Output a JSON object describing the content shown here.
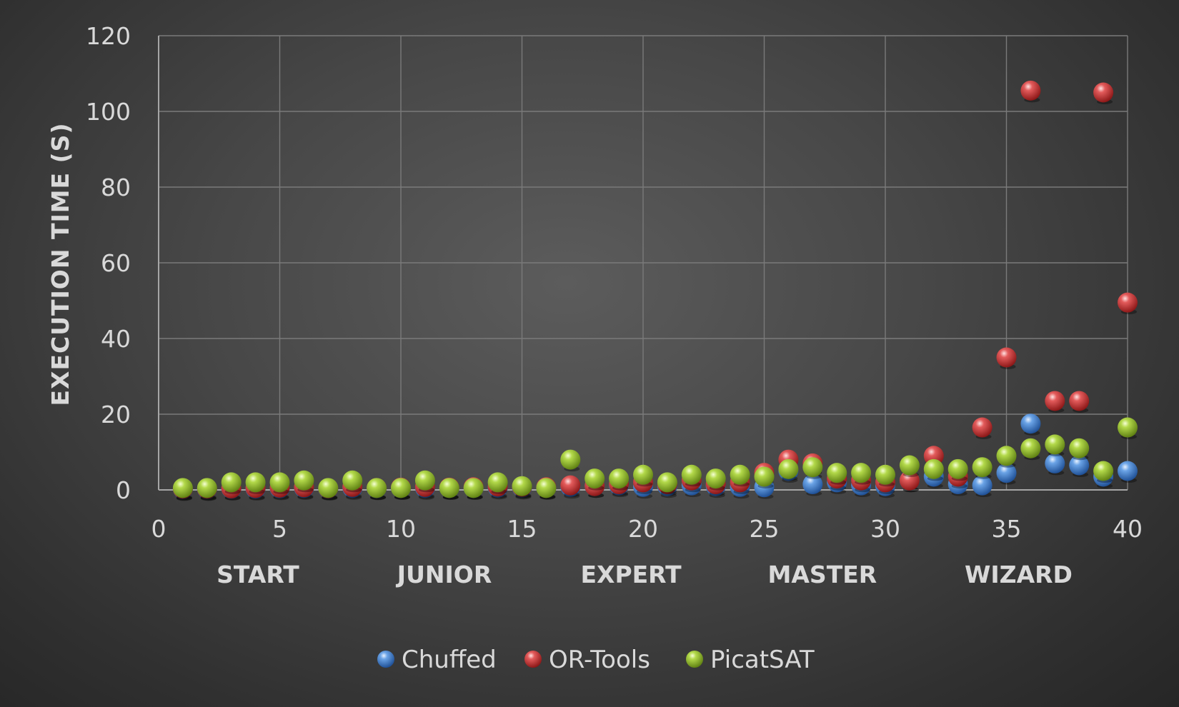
{
  "chart_data": {
    "type": "scatter",
    "title": "",
    "xlabel": "",
    "ylabel": "EXECUTION TIME (S)",
    "xlim": [
      0,
      40
    ],
    "ylim": [
      0,
      120
    ],
    "x_ticks": [
      0,
      5,
      10,
      15,
      20,
      25,
      30,
      35,
      40
    ],
    "y_ticks": [
      0,
      20,
      40,
      60,
      80,
      100,
      120
    ],
    "grid": true,
    "legend_position": "bottom",
    "category_labels": [
      {
        "label": "START",
        "center": 4.1
      },
      {
        "label": "JUNIOR",
        "center": 11.8
      },
      {
        "label": "EXPERT",
        "center": 19.5
      },
      {
        "label": "MASTER",
        "center": 27.4
      },
      {
        "label": "WIZARD",
        "center": 35.5
      }
    ],
    "series": [
      {
        "name": "Chuffed",
        "color": "#3d7fd0",
        "x": [
          1,
          2,
          3,
          4,
          5,
          6,
          7,
          8,
          9,
          10,
          11,
          12,
          13,
          14,
          15,
          16,
          17,
          18,
          19,
          20,
          21,
          22,
          23,
          24,
          25,
          26,
          27,
          28,
          29,
          30,
          31,
          32,
          33,
          34,
          35,
          36,
          37,
          38,
          39,
          40
        ],
        "y": [
          0.2,
          0.2,
          0.3,
          0.3,
          0.4,
          0.5,
          0.3,
          0.5,
          0.4,
          0.5,
          0.5,
          0.5,
          0.5,
          0.6,
          0.6,
          0.6,
          0.8,
          1.0,
          1.2,
          0.8,
          1.0,
          1.2,
          1.0,
          0.8,
          0.7,
          5.0,
          1.5,
          2.0,
          1.2,
          1.0,
          2.5,
          3.5,
          1.5,
          1.2,
          4.5,
          17.5,
          7.0,
          6.5,
          3.5,
          5.0
        ]
      },
      {
        "name": "OR-Tools",
        "color": "#d63a3a",
        "x": [
          1,
          2,
          3,
          4,
          5,
          6,
          7,
          8,
          9,
          10,
          11,
          12,
          13,
          14,
          15,
          16,
          17,
          18,
          19,
          20,
          21,
          22,
          23,
          24,
          25,
          26,
          27,
          28,
          29,
          30,
          31,
          32,
          33,
          34,
          35,
          36,
          37,
          38,
          39,
          40
        ],
        "y": [
          0.3,
          0.3,
          0.4,
          0.5,
          0.6,
          0.7,
          0.4,
          0.8,
          0.5,
          0.6,
          0.8,
          0.6,
          0.7,
          0.9,
          0.8,
          0.7,
          1.2,
          1.0,
          1.5,
          2.0,
          1.5,
          2.5,
          1.5,
          2.0,
          4.5,
          8.0,
          7.0,
          3.0,
          2.5,
          2.0,
          2.5,
          9.0,
          3.5,
          16.5,
          35.0,
          105.5,
          23.5,
          23.5,
          105.0,
          49.5
        ]
      },
      {
        "name": "PicatSAT",
        "color": "#98c22c",
        "x": [
          1,
          2,
          3,
          4,
          5,
          6,
          7,
          8,
          9,
          10,
          11,
          12,
          13,
          14,
          15,
          16,
          17,
          18,
          19,
          20,
          21,
          22,
          23,
          24,
          25,
          26,
          27,
          28,
          29,
          30,
          31,
          32,
          33,
          34,
          35,
          36,
          37,
          38,
          39,
          40
        ],
        "y": [
          0.5,
          0.5,
          2.0,
          2.0,
          2.0,
          2.5,
          0.5,
          2.5,
          0.5,
          0.5,
          2.5,
          0.5,
          0.5,
          2.0,
          1.0,
          0.5,
          8.0,
          3.0,
          3.0,
          4.0,
          2.0,
          4.0,
          3.0,
          4.0,
          3.5,
          5.5,
          6.0,
          4.5,
          4.5,
          4.0,
          6.5,
          5.5,
          5.5,
          6.0,
          9.0,
          11.0,
          12.0,
          11.0,
          5.0,
          16.5
        ]
      }
    ]
  }
}
